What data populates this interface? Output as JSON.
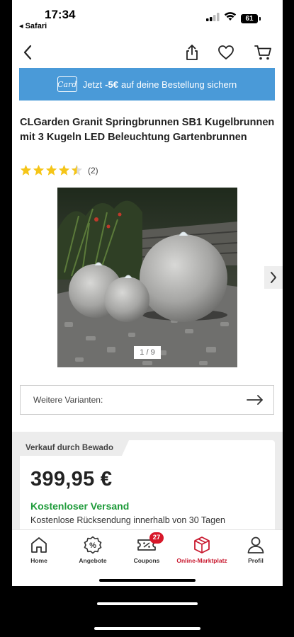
{
  "status_bar": {
    "time": "17:34",
    "back_app": "◂ Safari",
    "battery": "61"
  },
  "nav": {
    "back_icon": "chevron-left-icon",
    "share_icon": "share-icon",
    "wishlist_icon": "heart-icon",
    "cart_icon": "cart-icon"
  },
  "promo_banner": {
    "icon": "card-icon",
    "icon_text": "Card",
    "text_before": "Jetzt",
    "amount": "-5€",
    "text_after": "auf deine Bestellung sichern",
    "color": "#4a9ad8"
  },
  "product": {
    "title": "CLGarden Granit Springbrunnen SB1 Kugelbrunnen mit 3 Kugeln LED Beleuchtung Gartenbrunnen",
    "rating_value": 4.5,
    "rating_max": 5,
    "rating_count": "(2)",
    "star_color": "#f5c518",
    "image_counter": "1 / 9"
  },
  "variants": {
    "label": "Weitere Varianten:",
    "arrow_icon": "arrow-right-icon"
  },
  "offer": {
    "seller": "Verkauf durch Bewado",
    "price": "399,95 €",
    "shipping": "Kostenloser Versand",
    "shipping_color": "#1e9b3a",
    "returns": "Kostenlose Rücksendung innerhalb von 30 Tagen"
  },
  "tabbar": {
    "active_color": "#c9192f",
    "items": [
      {
        "label": "Home",
        "icon": "home-icon"
      },
      {
        "label": "Angebote",
        "icon": "percent-icon"
      },
      {
        "label": "Coupons",
        "icon": "coupon-icon",
        "badge": "27"
      },
      {
        "label": "Online-Marktplatz",
        "icon": "marketplace-icon"
      },
      {
        "label": "Profil",
        "icon": "profile-icon"
      }
    ]
  }
}
